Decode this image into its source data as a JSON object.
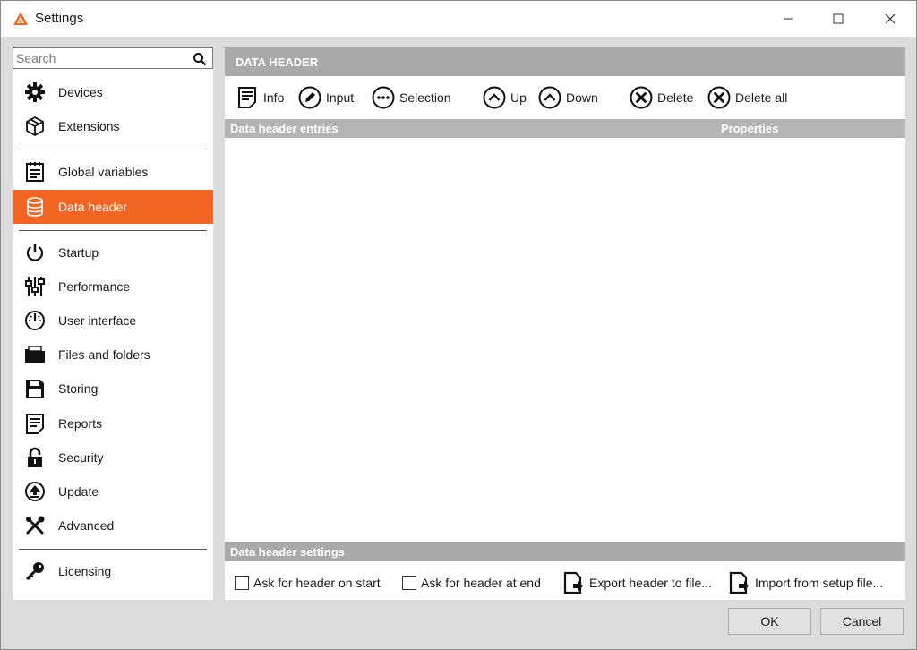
{
  "window": {
    "title": "Settings"
  },
  "search": {
    "placeholder": "Search"
  },
  "sidebar": {
    "items": [
      {
        "label": "Devices",
        "icon": "gear-icon"
      },
      {
        "label": "Extensions",
        "icon": "cube-icon"
      },
      {
        "label": "Global variables",
        "icon": "clipboard-icon"
      },
      {
        "label": "Data header",
        "icon": "database-icon",
        "active": true
      },
      {
        "label": "Startup",
        "icon": "power-icon"
      },
      {
        "label": "Performance",
        "icon": "sliders-icon"
      },
      {
        "label": "User interface",
        "icon": "gauge-icon"
      },
      {
        "label": "Files and folders",
        "icon": "folder-icon"
      },
      {
        "label": "Storing",
        "icon": "floppy-icon"
      },
      {
        "label": "Reports",
        "icon": "report-icon"
      },
      {
        "label": "Security",
        "icon": "lock-icon"
      },
      {
        "label": "Update",
        "icon": "update-icon"
      },
      {
        "label": "Advanced",
        "icon": "tools-icon"
      },
      {
        "label": "Licensing",
        "icon": "key-icon"
      }
    ]
  },
  "main": {
    "section_title": "DATA HEADER",
    "toolbar": {
      "info": "Info",
      "input": "Input",
      "selection": "Selection",
      "up": "Up",
      "down": "Down",
      "delete": "Delete",
      "delete_all": "Delete all"
    },
    "grid": {
      "columns": [
        "Data header entries",
        "Properties"
      ],
      "rows": []
    },
    "settings_title": "Data header settings",
    "options": {
      "ask_on_start": {
        "label": "Ask for header on start",
        "checked": false
      },
      "ask_at_end": {
        "label": "Ask for header at end",
        "checked": false
      },
      "export": "Export header to file...",
      "import": "Import from setup file..."
    }
  },
  "footer": {
    "ok": "OK",
    "cancel": "Cancel"
  },
  "colors": {
    "accent": "#f26522",
    "header_bg": "#a9a9a9"
  }
}
